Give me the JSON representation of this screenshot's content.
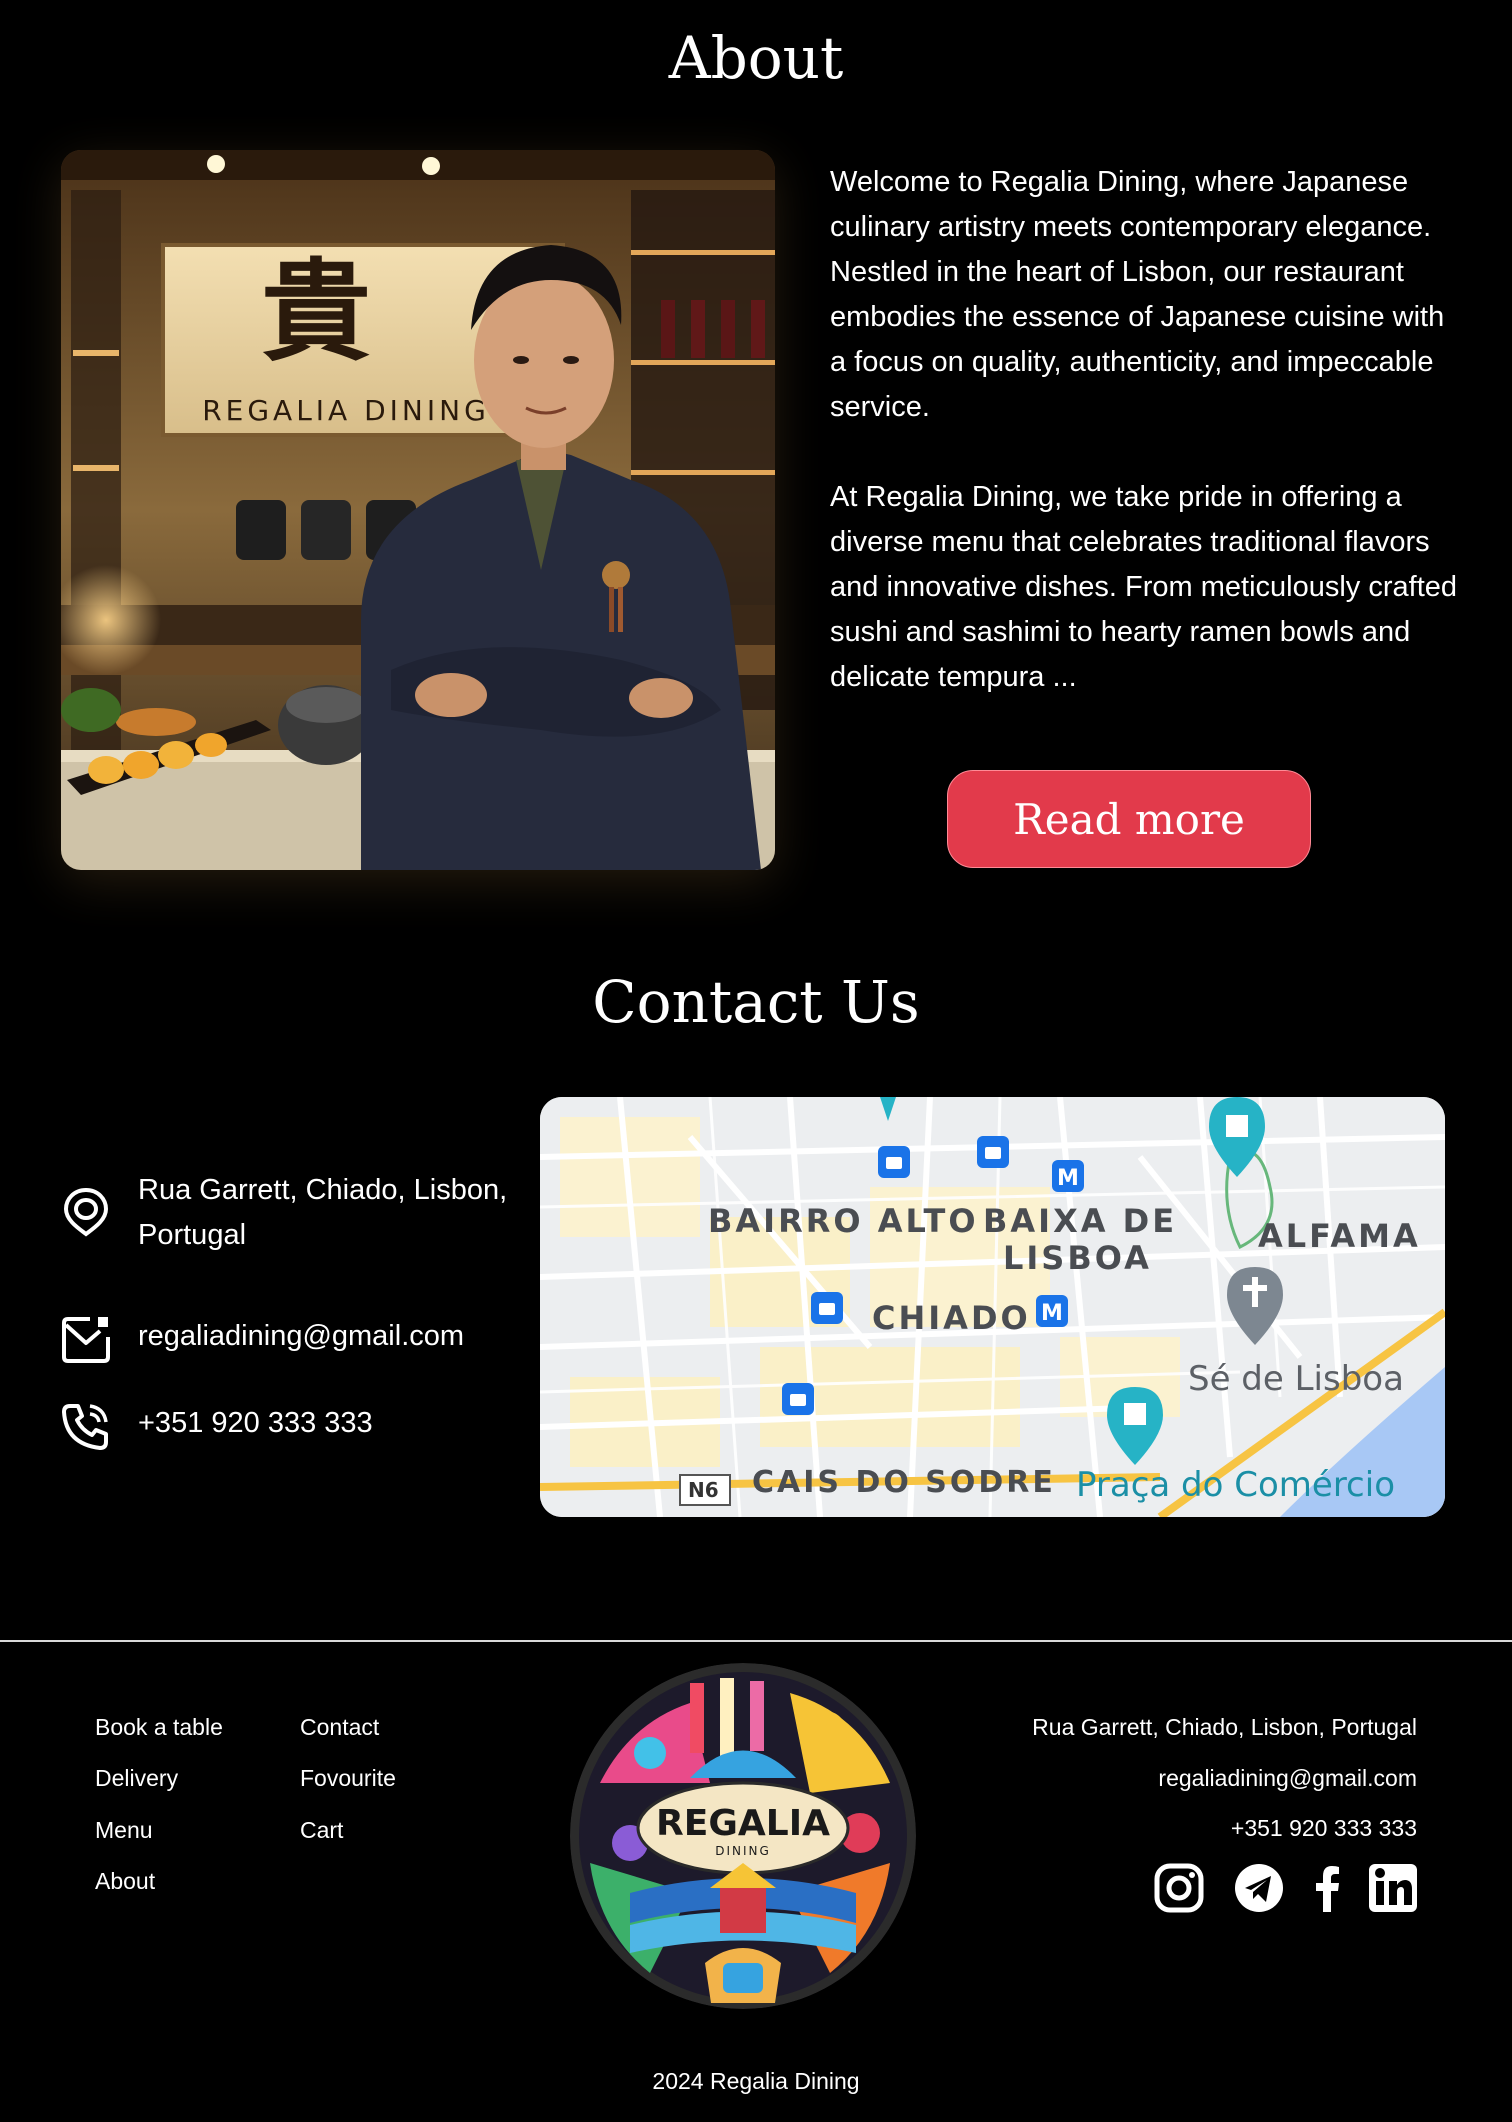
{
  "about": {
    "title": "About",
    "paragraph1": "Welcome to Regalia Dining, where Japanese culinary artistry meets contemporary elegance. Nestled in the heart of  Lisbon, our restaurant embodies the essence of Japanese cuisine with a focus on quality, authenticity, and impeccable service.",
    "paragraph2": "At Regalia Dining, we take pride in offering a diverse menu that celebrates traditional flavors and innovative dishes. From meticulously crafted sushi and sashimi to hearty ramen bowls and delicate tempura ...",
    "read_more_label": "Read more",
    "photo_sign_text": "REGALIA DINING"
  },
  "contact": {
    "title": "Contact Us",
    "address": "Rua Garrett, Chiado, Lisbon, Portugal",
    "email": "regaliadining@gmail.com",
    "phone": "+351 920 333 333"
  },
  "map": {
    "labels": {
      "bairro_alto": "BAIRRO ALTO",
      "baixa": "BAIXA DE",
      "lisboa": "LISBOA",
      "alfama": "ALFAMA",
      "chiado": "CHIADO",
      "se_de_lisboa": "Sé de Lisboa",
      "cais_do_sodre": "CAIS DO SODRE",
      "praca": "Praça do Comércio",
      "road": "N6"
    }
  },
  "footer": {
    "links_col1": [
      "Book a table",
      "Delivery",
      "Menu",
      "About"
    ],
    "links_col2": [
      "Contact",
      "Fovourite",
      "Cart"
    ],
    "address": "Rua Garrett, Chiado, Lisbon, Portugal",
    "email": "regaliadining@gmail.com",
    "phone": "+351 920 333 333",
    "logo_text": "REGALIA",
    "logo_subtext": "DINING",
    "copyright": "2024  Regalia Dining"
  },
  "colors": {
    "accent": "#e23a4b",
    "background": "#000000",
    "text": "#ffffff"
  },
  "icons": [
    "location-pin-icon",
    "mail-icon",
    "phone-icon",
    "instagram-icon",
    "telegram-icon",
    "facebook-icon",
    "linkedin-icon"
  ]
}
